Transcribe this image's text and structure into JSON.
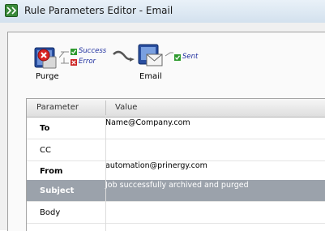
{
  "window": {
    "title": "Rule Parameters Editor - Email"
  },
  "workflow": {
    "source": {
      "label": "Purge",
      "icon": "purge-icon"
    },
    "outputs": [
      {
        "label": "Success",
        "status": "check",
        "color": "#2e9a2e"
      },
      {
        "label": "Error",
        "status": "error",
        "color": "#cc2222"
      }
    ],
    "target": {
      "label": "Email",
      "icon": "email-icon"
    },
    "target_output": {
      "label": "Sent",
      "status": "check"
    }
  },
  "grid": {
    "columns": [
      "Parameter",
      "Value"
    ],
    "rows": [
      {
        "name": "To",
        "value": "Name@Company.com",
        "bold": true,
        "selected": false
      },
      {
        "name": "CC",
        "value": "",
        "bold": false,
        "selected": false
      },
      {
        "name": "From",
        "value": "automation@prinergy.com",
        "bold": true,
        "selected": false
      },
      {
        "name": "Subject",
        "value": "Job successfully archived and purged",
        "bold": true,
        "selected": true
      },
      {
        "name": "Body",
        "value": "",
        "bold": false,
        "selected": false
      }
    ]
  },
  "colors": {
    "selected_row": "#9ba2ab",
    "link_blue": "#1f2f9f"
  }
}
